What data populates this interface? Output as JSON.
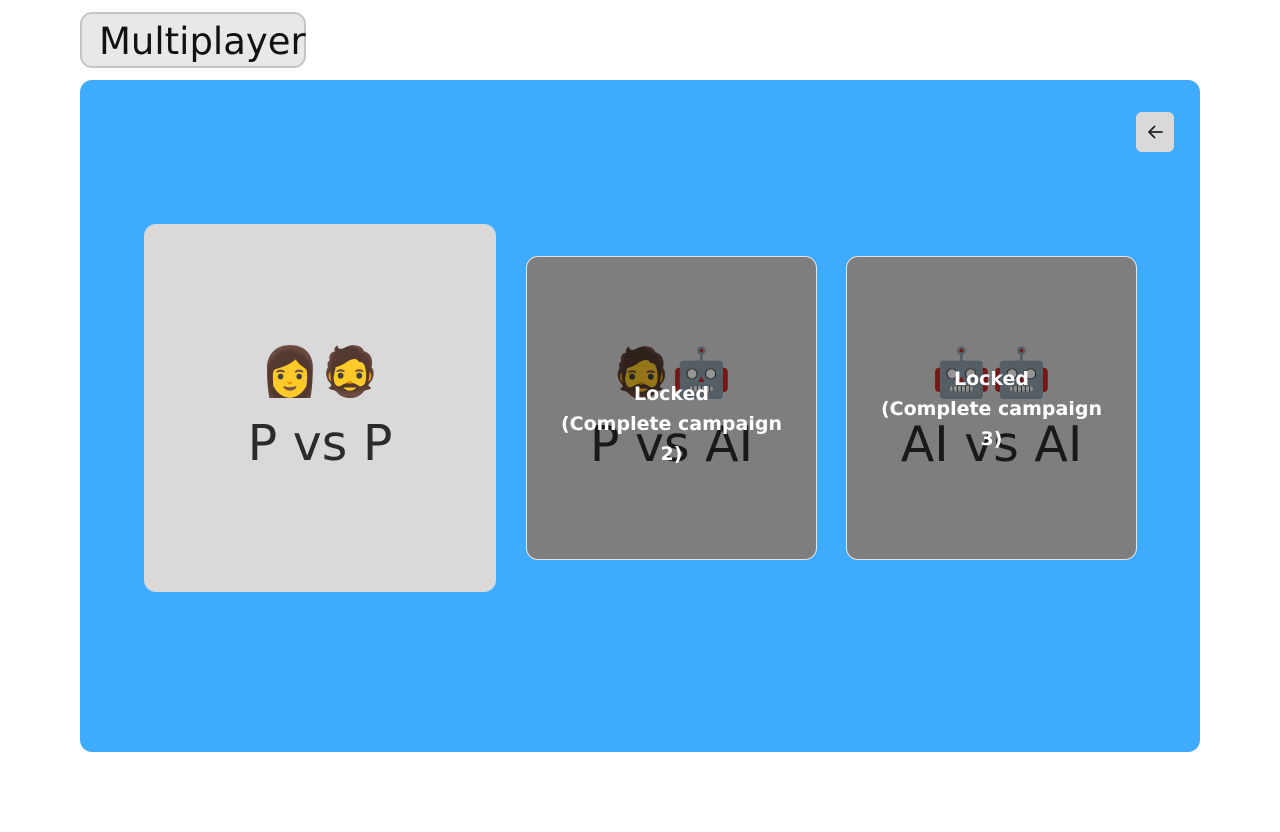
{
  "header": {
    "title": "Multiplayer"
  },
  "panel": {
    "background_color": "#3eabfe",
    "back_button": {
      "icon": "arrow-left-icon"
    }
  },
  "modes": [
    {
      "emoji": "👩🧔",
      "label": "P vs P",
      "locked": false
    },
    {
      "emoji": "🧔🤖",
      "label": "P vs AI",
      "locked": true,
      "lock_title": "Locked",
      "lock_reason": "(Complete campaign 2)"
    },
    {
      "emoji": "🤖🤖",
      "label": "AI vs AI",
      "locked": true,
      "lock_title": "Locked",
      "lock_reason": "(Complete campaign 3)"
    }
  ]
}
